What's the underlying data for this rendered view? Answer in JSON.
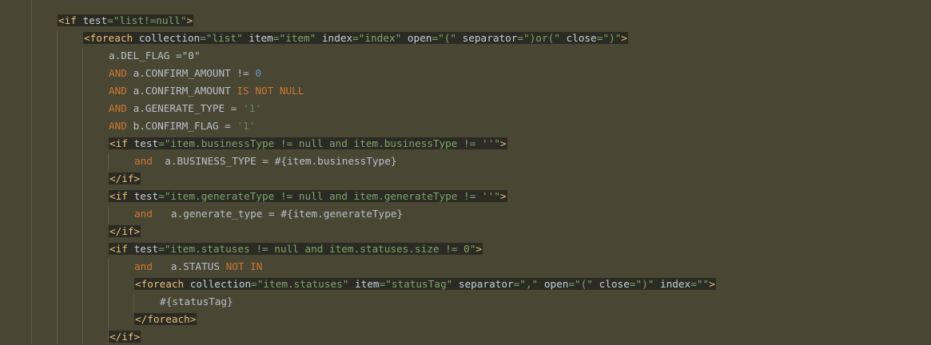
{
  "editor": {
    "language": "xml-mybatis",
    "lines": [
      {
        "indent": 0,
        "segments": [
          {
            "t": "<if ",
            "c": "tag"
          },
          {
            "t": "test",
            "c": "attr"
          },
          {
            "t": "=\"list!=null\"",
            "c": "val"
          },
          {
            "t": ">",
            "c": "tag"
          }
        ],
        "highlight": true
      },
      {
        "indent": 1,
        "segments": [
          {
            "t": "<foreach ",
            "c": "tag"
          },
          {
            "t": "collection",
            "c": "attr"
          },
          {
            "t": "=\"list\" ",
            "c": "val"
          },
          {
            "t": "item",
            "c": "attr"
          },
          {
            "t": "=\"item\" ",
            "c": "val"
          },
          {
            "t": "index",
            "c": "attr"
          },
          {
            "t": "=\"index\" ",
            "c": "val"
          },
          {
            "t": "open",
            "c": "attr"
          },
          {
            "t": "=\"(\" ",
            "c": "val"
          },
          {
            "t": "separator",
            "c": "attr"
          },
          {
            "t": "=\")or(\" ",
            "c": "val"
          },
          {
            "t": "close",
            "c": "attr"
          },
          {
            "t": "=\")\"",
            "c": "val"
          },
          {
            "t": ">",
            "c": "tag"
          }
        ],
        "highlight": true
      },
      {
        "indent": 2,
        "segments": [
          {
            "t": "a.DEL_FLAG =\"0\"",
            "c": "plain"
          }
        ],
        "highlight": false
      },
      {
        "indent": 2,
        "segments": [
          {
            "t": "AND ",
            "c": "kw"
          },
          {
            "t": "a.CONFIRM_AMOUNT != ",
            "c": "plain"
          },
          {
            "t": "0",
            "c": "num"
          }
        ],
        "highlight": false
      },
      {
        "indent": 2,
        "segments": [
          {
            "t": "AND ",
            "c": "kw"
          },
          {
            "t": "a.CONFIRM_AMOUNT ",
            "c": "plain"
          },
          {
            "t": "IS NOT NULL",
            "c": "kw"
          }
        ],
        "highlight": false
      },
      {
        "indent": 2,
        "segments": [
          {
            "t": "AND ",
            "c": "kw"
          },
          {
            "t": "a.GENERATE_TYPE = ",
            "c": "plain"
          },
          {
            "t": "'1'",
            "c": "str"
          }
        ],
        "highlight": false
      },
      {
        "indent": 2,
        "segments": [
          {
            "t": "AND ",
            "c": "kw"
          },
          {
            "t": "b.CONFIRM_FLAG = ",
            "c": "plain"
          },
          {
            "t": "'1'",
            "c": "str"
          }
        ],
        "highlight": false
      },
      {
        "indent": 2,
        "segments": [
          {
            "t": "<if ",
            "c": "tag"
          },
          {
            "t": "test",
            "c": "attr"
          },
          {
            "t": "=\"item.businessType != null and item.businessType != ''\"",
            "c": "val"
          },
          {
            "t": ">",
            "c": "tag"
          }
        ],
        "highlight": true
      },
      {
        "indent": 3,
        "segments": [
          {
            "t": "and  ",
            "c": "kw"
          },
          {
            "t": "a.BUSINESS_TYPE = #{item.businessType}",
            "c": "plain"
          }
        ],
        "highlight": false
      },
      {
        "indent": 2,
        "segments": [
          {
            "t": "</if>",
            "c": "tag"
          }
        ],
        "highlight": true
      },
      {
        "indent": 2,
        "segments": [
          {
            "t": "<if ",
            "c": "tag"
          },
          {
            "t": "test",
            "c": "attr"
          },
          {
            "t": "=\"item.generateType != null and item.generateType != ''\"",
            "c": "val"
          },
          {
            "t": ">",
            "c": "tag"
          }
        ],
        "highlight": true
      },
      {
        "indent": 3,
        "segments": [
          {
            "t": "and   ",
            "c": "kw"
          },
          {
            "t": "a.generate_type = #{item.generateType}",
            "c": "plain"
          }
        ],
        "highlight": false
      },
      {
        "indent": 2,
        "segments": [
          {
            "t": "</if>",
            "c": "tag"
          }
        ],
        "highlight": true
      },
      {
        "indent": 2,
        "segments": [
          {
            "t": "<if ",
            "c": "tag"
          },
          {
            "t": "test",
            "c": "attr"
          },
          {
            "t": "=\"item.statuses != null and item.statuses.size != 0\"",
            "c": "val"
          },
          {
            "t": ">",
            "c": "tag"
          }
        ],
        "highlight": true
      },
      {
        "indent": 3,
        "segments": [
          {
            "t": "and   ",
            "c": "kw"
          },
          {
            "t": "a.STATUS ",
            "c": "plain"
          },
          {
            "t": "NOT IN",
            "c": "kw"
          }
        ],
        "highlight": false
      },
      {
        "indent": 3,
        "segments": [
          {
            "t": "<foreach ",
            "c": "tag"
          },
          {
            "t": "collection",
            "c": "attr"
          },
          {
            "t": "=\"item.statuses\" ",
            "c": "val"
          },
          {
            "t": "item",
            "c": "attr"
          },
          {
            "t": "=\"statusTag\" ",
            "c": "val"
          },
          {
            "t": "separator",
            "c": "attr"
          },
          {
            "t": "=\",\" ",
            "c": "val"
          },
          {
            "t": "open",
            "c": "attr"
          },
          {
            "t": "=\"(\" ",
            "c": "val"
          },
          {
            "t": "close",
            "c": "attr"
          },
          {
            "t": "=\")\" ",
            "c": "val"
          },
          {
            "t": "index",
            "c": "attr"
          },
          {
            "t": "=\"\"",
            "c": "val"
          },
          {
            "t": ">",
            "c": "tag"
          }
        ],
        "highlight": true
      },
      {
        "indent": 4,
        "segments": [
          {
            "t": "#{statusTag}",
            "c": "plain"
          }
        ],
        "highlight": false
      },
      {
        "indent": 3,
        "segments": [
          {
            "t": "</foreach>",
            "c": "tag"
          }
        ],
        "highlight": true
      },
      {
        "indent": 2,
        "segments": [
          {
            "t": "</if>",
            "c": "tag"
          }
        ],
        "highlight": true
      }
    ]
  }
}
